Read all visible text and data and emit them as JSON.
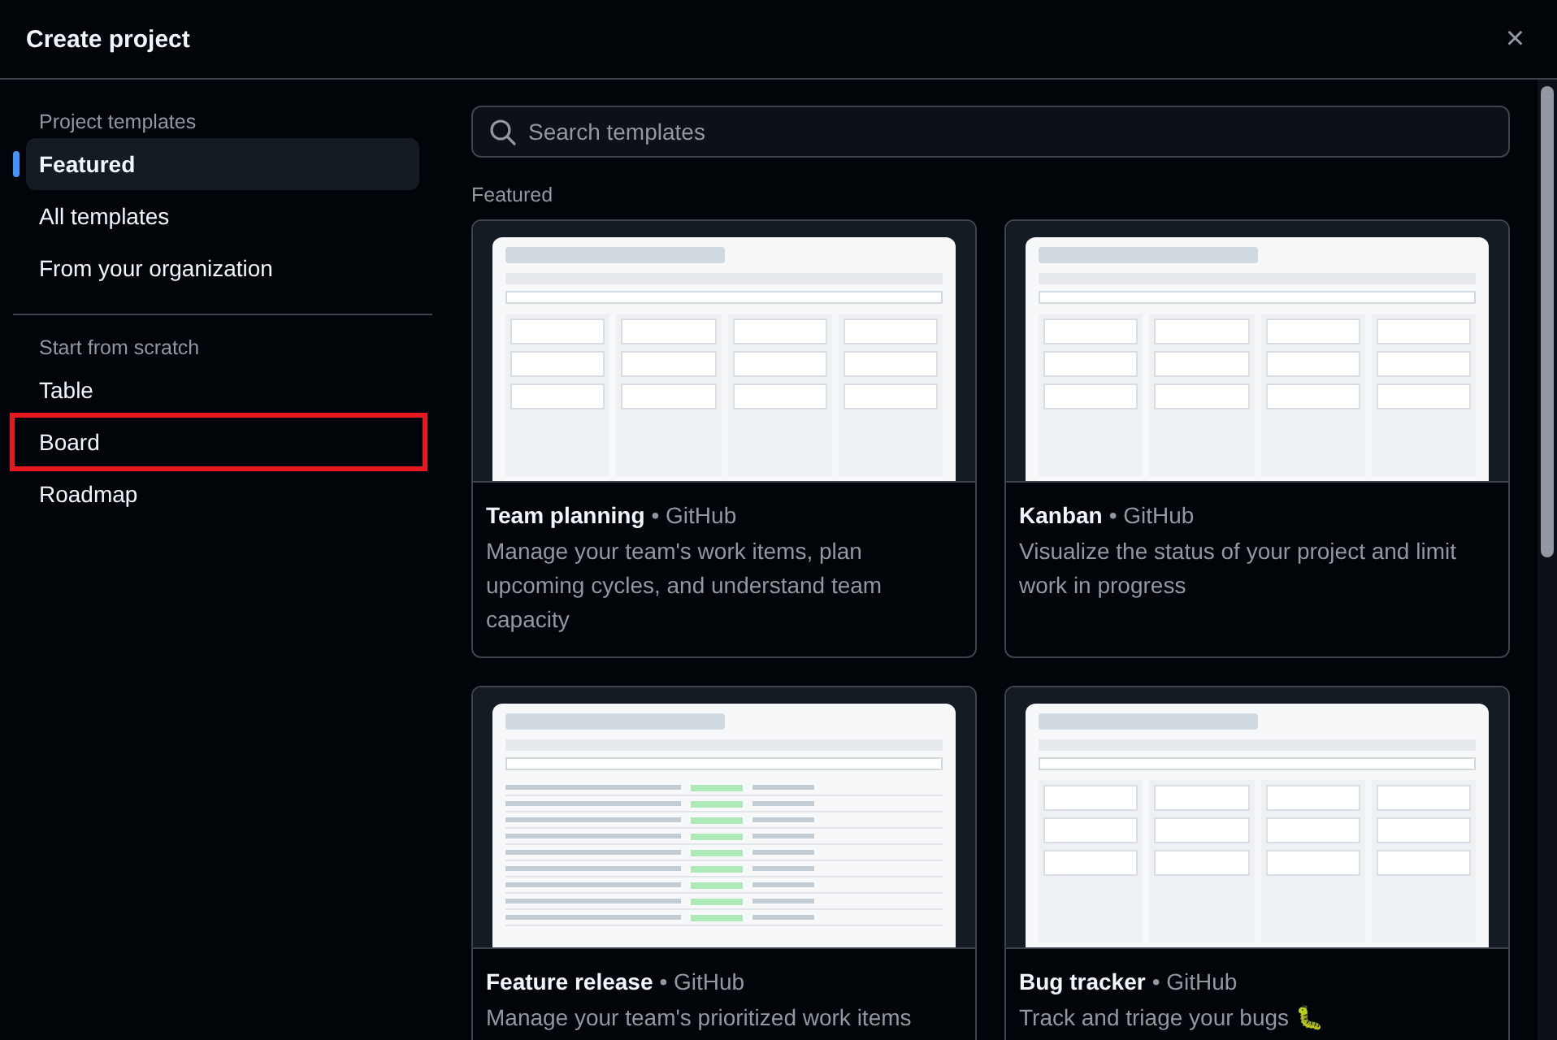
{
  "dialog": {
    "title": "Create project",
    "close": "×"
  },
  "sidebar": {
    "sections": [
      {
        "heading": "Project templates",
        "items": [
          {
            "label": "Featured",
            "selected": true,
            "highlighted": false
          },
          {
            "label": "All templates",
            "selected": false,
            "highlighted": false
          },
          {
            "label": "From your organization",
            "selected": false,
            "highlighted": false
          }
        ]
      },
      {
        "heading": "Start from scratch",
        "items": [
          {
            "label": "Table",
            "selected": false,
            "highlighted": false
          },
          {
            "label": "Board",
            "selected": false,
            "highlighted": true
          },
          {
            "label": "Roadmap",
            "selected": false,
            "highlighted": false
          }
        ]
      }
    ]
  },
  "search": {
    "placeholder": "Search templates"
  },
  "section_title": "Featured",
  "templates": [
    {
      "kind": "board",
      "name": "Team planning",
      "author": "• GitHub",
      "description": "Manage your team's work items, plan upcoming cycles, and understand team capacity"
    },
    {
      "kind": "board",
      "name": "Kanban",
      "author": "• GitHub",
      "description": "Visualize the status of your project and limit work in progress"
    },
    {
      "kind": "table",
      "name": "Feature release",
      "author": "• GitHub",
      "description": "Manage your team's prioritized work items"
    },
    {
      "kind": "board",
      "name": "Bug tracker",
      "author": "• GitHub",
      "description": "Track and triage your bugs 🐛"
    }
  ]
}
